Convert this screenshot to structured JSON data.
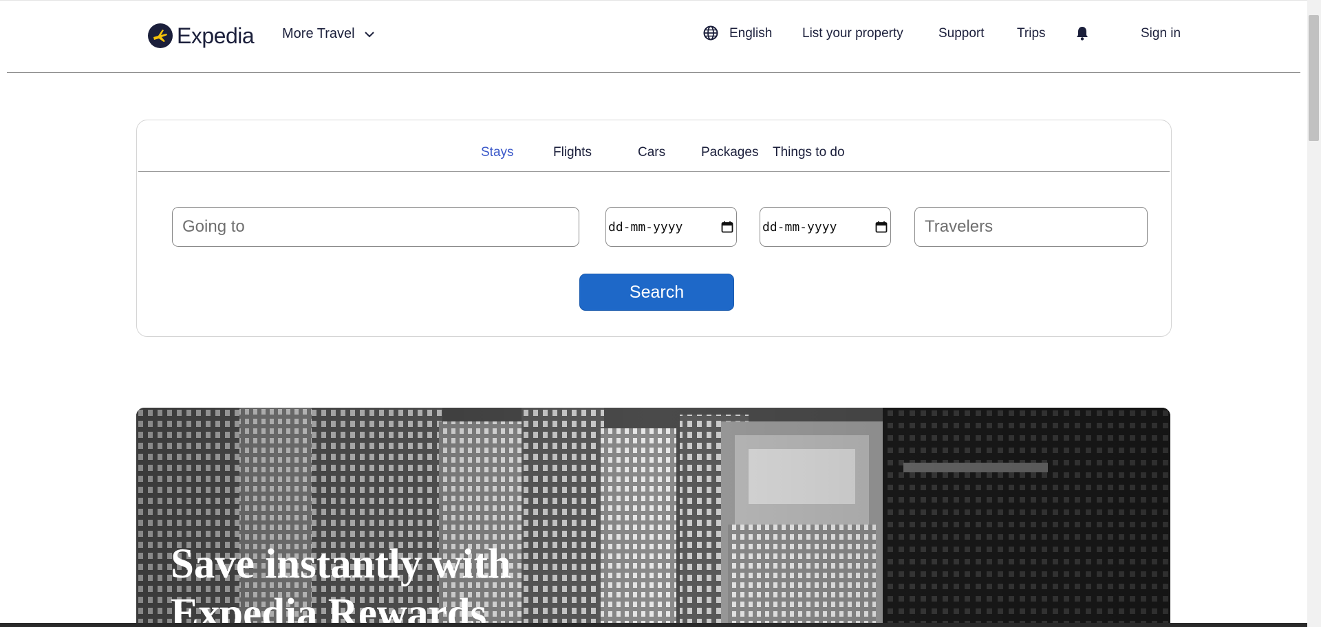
{
  "header": {
    "logo_text": "Expedia",
    "more_travel": "More Travel",
    "language": "English",
    "list_property": "List your property",
    "support": "Support",
    "trips": "Trips",
    "sign_in": "Sign in",
    "icons": [
      "globe-icon",
      "bell-icon",
      "chevron-down-icon",
      "expedia-logo-icon"
    ]
  },
  "search": {
    "tabs": [
      {
        "label": "Stays",
        "active": true
      },
      {
        "label": "Flights",
        "active": false
      },
      {
        "label": "Cars",
        "active": false
      },
      {
        "label": "Packages",
        "active": false
      },
      {
        "label": "Things to do",
        "active": false
      }
    ],
    "going_to_placeholder": "Going to",
    "check_in_value": "dd-mm-yyyy",
    "check_out_value": "dd-mm-yyyy",
    "travelers_placeholder": "Travelers",
    "search_label": "Search"
  },
  "hero": {
    "title": "Save instantly with Expedia Rewards"
  },
  "colors": {
    "brand_dark": "#1b1f3b",
    "active_tab": "#3a58c9",
    "search_button": "#1e68c8"
  }
}
